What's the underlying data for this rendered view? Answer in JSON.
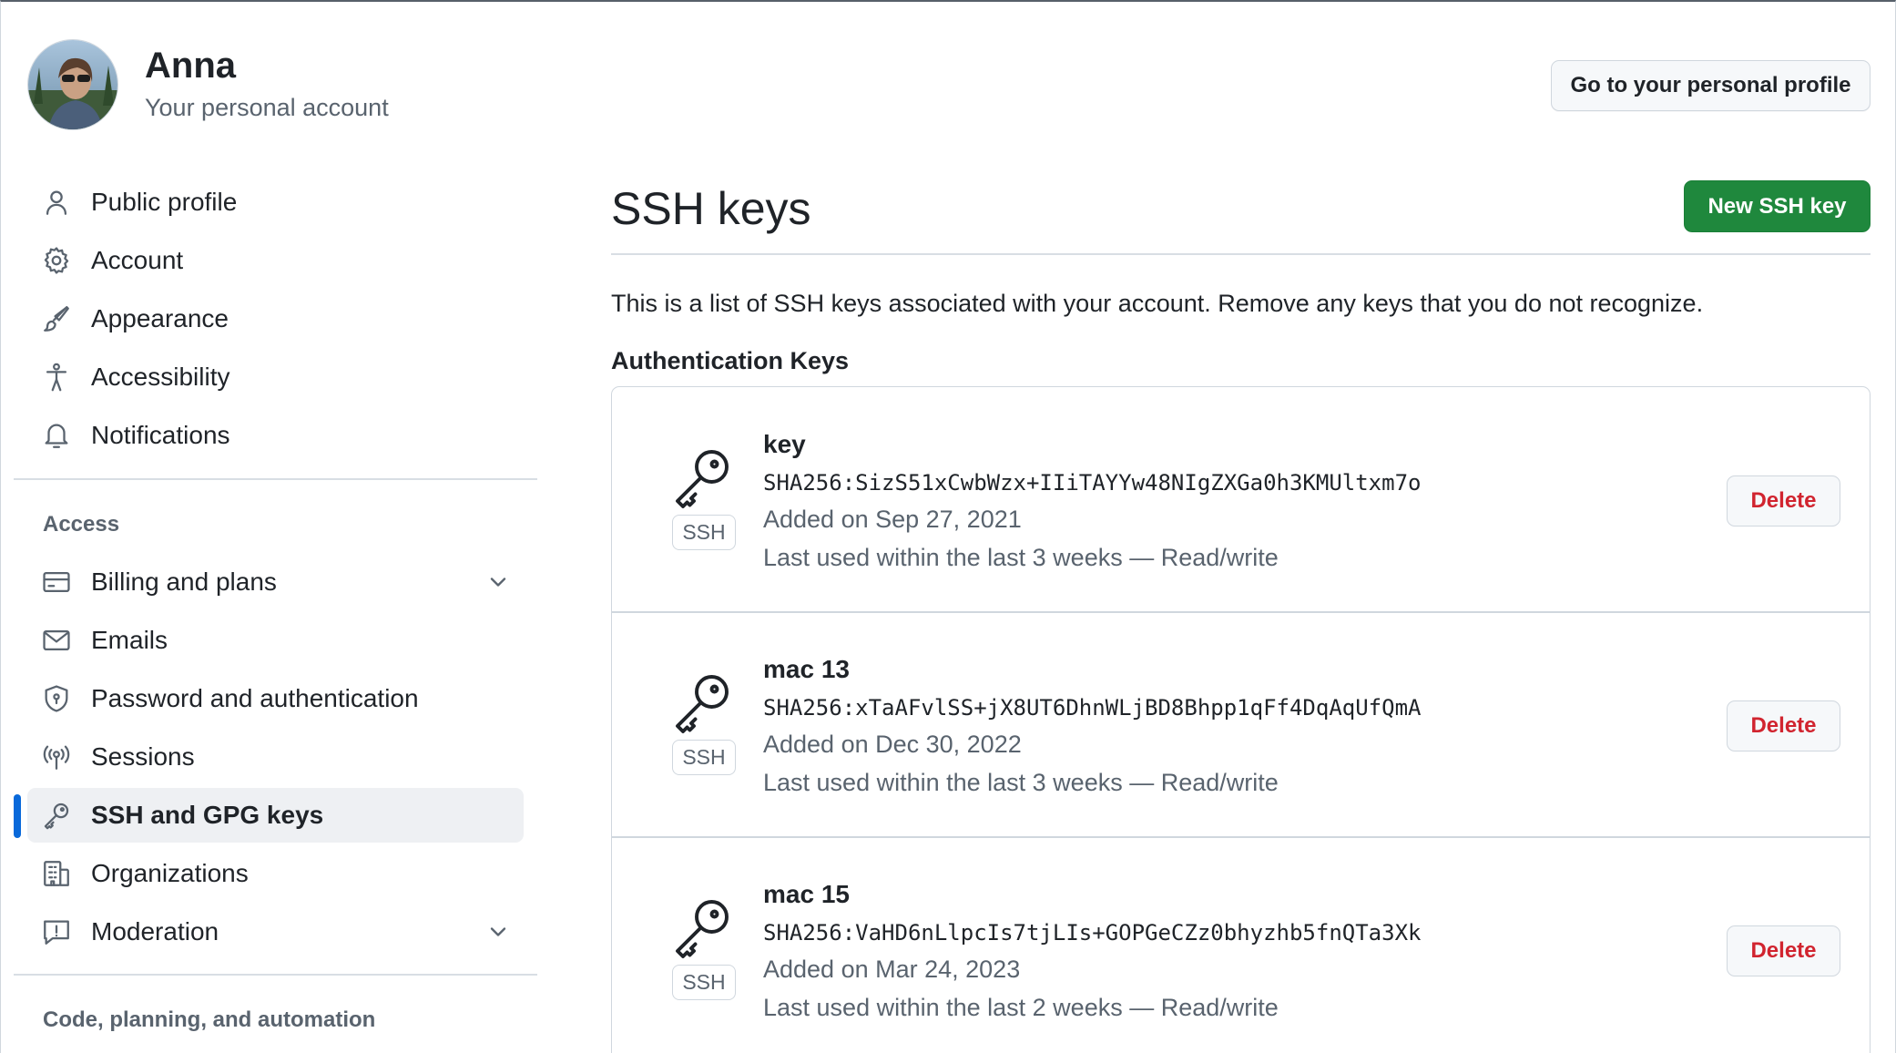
{
  "header": {
    "account_name": "Anna",
    "account_subtitle": "Your personal account",
    "profile_button": "Go to your personal profile"
  },
  "sidebar": {
    "items": [
      {
        "label": "Public profile",
        "icon": "person-icon"
      },
      {
        "label": "Account",
        "icon": "gear-icon"
      },
      {
        "label": "Appearance",
        "icon": "paintbrush-icon"
      },
      {
        "label": "Accessibility",
        "icon": "accessibility-icon"
      },
      {
        "label": "Notifications",
        "icon": "bell-icon"
      }
    ],
    "access_title": "Access",
    "access_items": [
      {
        "label": "Billing and plans",
        "icon": "credit-card-icon",
        "expandable": true
      },
      {
        "label": "Emails",
        "icon": "mail-icon"
      },
      {
        "label": "Password and authentication",
        "icon": "shield-lock-icon"
      },
      {
        "label": "Sessions",
        "icon": "broadcast-icon"
      },
      {
        "label": "SSH and GPG keys",
        "icon": "key-icon",
        "active": true
      },
      {
        "label": "Organizations",
        "icon": "organization-icon"
      },
      {
        "label": "Moderation",
        "icon": "report-icon",
        "expandable": true
      }
    ],
    "code_title": "Code, planning, and automation"
  },
  "main": {
    "title": "SSH keys",
    "new_button": "New SSH key",
    "description": "This is a list of SSH keys associated with your account. Remove any keys that you do not recognize.",
    "auth_heading": "Authentication Keys",
    "keys": [
      {
        "title": "key",
        "fingerprint": "SHA256:SizS51xCwbWzx+IIiTAYYw48NIgZXGa0h3KMUltxm7o",
        "added": "Added on Sep 27, 2021",
        "last_used": "Last used within the last 3 weeks — Read/write",
        "badge": "SSH",
        "delete_label": "Delete"
      },
      {
        "title": "mac 13",
        "fingerprint": "SHA256:xTaAFvlSS+jX8UT6DhnWLjBD8Bhpp1qFf4DqAqUfQmA",
        "added": "Added on Dec 30, 2022",
        "last_used": "Last used within the last 3 weeks — Read/write",
        "badge": "SSH",
        "delete_label": "Delete"
      },
      {
        "title": "mac 15",
        "fingerprint": "SHA256:VaHD6nLlpcIs7tjLIs+GOPGeCZz0bhyzhb5fnQTa3Xk",
        "added": "Added on Mar 24, 2023",
        "last_used": "Last used within the last 2 weeks — Read/write",
        "badge": "SSH",
        "delete_label": "Delete"
      }
    ]
  },
  "colors": {
    "primary_green": "#1f883d",
    "danger_red": "#d1242f",
    "accent_blue": "#0969da",
    "muted_text": "#59636e"
  }
}
